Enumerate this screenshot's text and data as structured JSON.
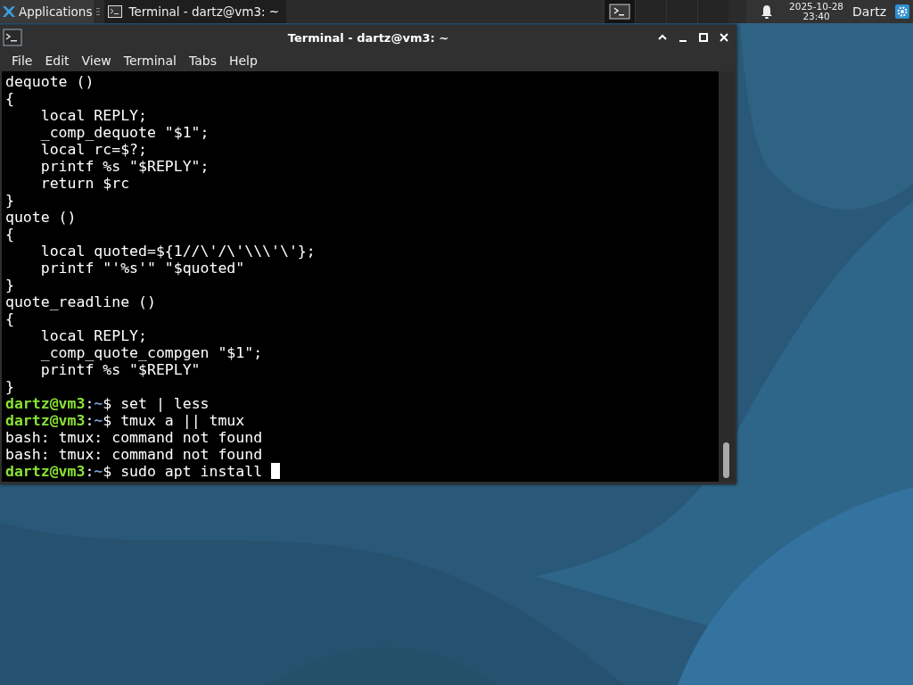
{
  "panel": {
    "apps_menu": {
      "label": "Applications"
    },
    "tasks": [
      {
        "label": "Terminal - dartz@vm3: ~",
        "selected": true
      }
    ],
    "workspaces": [
      {
        "selected": true,
        "has_window": true
      },
      {
        "selected": false,
        "has_window": false
      },
      {
        "selected": false,
        "has_window": false
      },
      {
        "selected": false,
        "has_window": false
      }
    ],
    "clock": {
      "date": "2025-10-28",
      "time": "23:40"
    },
    "user": "Dartz"
  },
  "window": {
    "title": "Terminal - dartz@vm3: ~",
    "menu": [
      "File",
      "Edit",
      "View",
      "Terminal",
      "Tabs",
      "Help"
    ],
    "lines": [
      {
        "kind": "text",
        "text": "dequote ()"
      },
      {
        "kind": "text",
        "text": "{"
      },
      {
        "kind": "text",
        "text": "    local REPLY;"
      },
      {
        "kind": "text",
        "text": "    _comp_dequote \"$1\";"
      },
      {
        "kind": "text",
        "text": "    local rc=$?;"
      },
      {
        "kind": "text",
        "text": "    printf %s \"$REPLY\";"
      },
      {
        "kind": "text",
        "text": "    return $rc"
      },
      {
        "kind": "text",
        "text": "}"
      },
      {
        "kind": "text",
        "text": "quote ()"
      },
      {
        "kind": "text",
        "text": "{"
      },
      {
        "kind": "text",
        "text": "    local quoted=${1//\\'/\\'\\\\\\'\\'};"
      },
      {
        "kind": "text",
        "text": "    printf \"'%s'\" \"$quoted\""
      },
      {
        "kind": "text",
        "text": "}"
      },
      {
        "kind": "text",
        "text": "quote_readline ()"
      },
      {
        "kind": "text",
        "text": "{"
      },
      {
        "kind": "text",
        "text": "    local REPLY;"
      },
      {
        "kind": "text",
        "text": "    _comp_quote_compgen \"$1\";"
      },
      {
        "kind": "text",
        "text": "    printf %s \"$REPLY\""
      },
      {
        "kind": "text",
        "text": "}"
      },
      {
        "kind": "prompt",
        "user": "dartz@vm3",
        "sep": ":",
        "path": "~",
        "sigil": "$",
        "command": "set | less"
      },
      {
        "kind": "prompt",
        "user": "dartz@vm3",
        "sep": ":",
        "path": "~",
        "sigil": "$",
        "command": "tmux a || tmux"
      },
      {
        "kind": "text",
        "text": "bash: tmux: command not found"
      },
      {
        "kind": "text",
        "text": "bash: tmux: command not found"
      },
      {
        "kind": "prompt",
        "user": "dartz@vm3",
        "sep": ":",
        "path": "~",
        "sigil": "$",
        "command": "sudo apt install",
        "cursor": true
      }
    ]
  }
}
